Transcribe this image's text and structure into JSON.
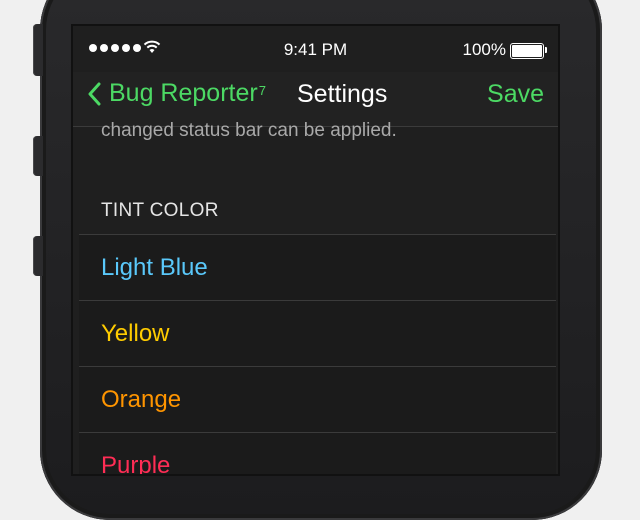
{
  "status_bar": {
    "time": "9:41 PM",
    "battery": "100%"
  },
  "nav": {
    "back_label": "Bug Reporter",
    "back_superscript": "7",
    "title": "Settings",
    "save_label": "Save"
  },
  "content": {
    "footer_text": "changed status bar can be applied.",
    "section_header": "TINT COLOR",
    "options": [
      {
        "label": "Light Blue",
        "color": "#5ac8fa"
      },
      {
        "label": "Yellow",
        "color": "#ffcc00"
      },
      {
        "label": "Orange",
        "color": "#ff9500"
      },
      {
        "label": "Purple",
        "color": "#ff2d55"
      }
    ]
  },
  "colors": {
    "accent": "#4cd964",
    "background": "#1f1f1f",
    "separator": "#3b3b3b"
  }
}
